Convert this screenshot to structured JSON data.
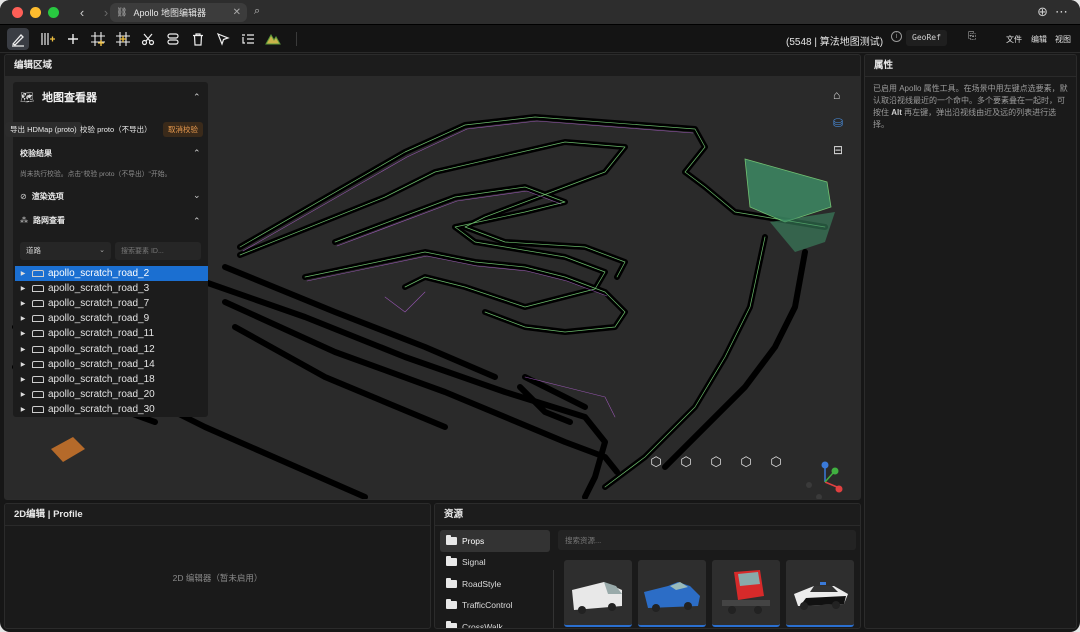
{
  "browser": {
    "tab_title": "Apollo 地图编辑器",
    "tab_close": "✕",
    "back": "‹",
    "forward": "›",
    "reload": "↻"
  },
  "toolbar": {
    "project_label": "(5548 | 算法地图测试)",
    "georef_label": "GeoRef",
    "menus": [
      "文件",
      "编辑",
      "视图"
    ],
    "tools": [
      "draw-icon",
      "grid-add-icon",
      "plus-icon",
      "junction-icon",
      "junction-add-icon",
      "scissors-icon",
      "connect-icon",
      "trash-icon",
      "select-cursor-icon",
      "list-icon",
      "terrain-icon"
    ]
  },
  "editor": {
    "title": "编辑区域"
  },
  "map_viewer": {
    "title": "地图查看器",
    "hdmap_button": "导出 HDMap (proto)",
    "validate_button": "校验 proto（不导出）",
    "cancel_button": "取消校验",
    "validation_section": "校验结果",
    "validation_hint": "尚未执行校验。点击\"校验 proto（不导出）\"开始。",
    "render_section": "渲染选项",
    "network_section": "路网查看",
    "type_select": "道路",
    "search_placeholder": "搜索要素 ID...",
    "roads": [
      "apollo_scratch_road_2",
      "apollo_scratch_road_3",
      "apollo_scratch_road_7",
      "apollo_scratch_road_9",
      "apollo_scratch_road_11",
      "apollo_scratch_road_12",
      "apollo_scratch_road_14",
      "apollo_scratch_road_18",
      "apollo_scratch_road_20",
      "apollo_scratch_road_30"
    ],
    "selected_road": "apollo_scratch_road_2"
  },
  "properties": {
    "title": "属性",
    "text_1": "已启用 Apollo 属性工具。在场景中用左键点选要素，默认取沿视线最近的一个命中。多个要素叠在一起时，可按住 ",
    "text_key": "Alt",
    "text_2": " 再左键，弹出沿视线由近及远的列表进行选择。"
  },
  "profile": {
    "title": "2D编辑 | Profile",
    "empty_text": "2D 编辑器（暂未启用）"
  },
  "assets": {
    "title": "资源",
    "search_placeholder": "搜索资源...",
    "categories": [
      "Props",
      "Signal",
      "RoadStyle",
      "TrafficControl",
      "CrossWalk"
    ],
    "selected_category": "Props",
    "items": [
      "white-van",
      "blue-pickup",
      "red-truck",
      "police-car"
    ]
  },
  "colors": {
    "accent": "#1b6fd1",
    "cancel": "#e89a4e",
    "road_outline": "#7fdc7f",
    "junction_fill": "#3d8a64"
  }
}
